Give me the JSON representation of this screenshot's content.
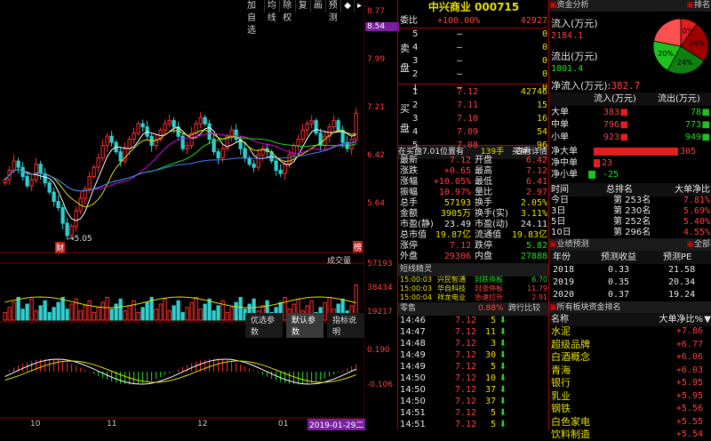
{
  "toolbar": {
    "items": [
      "加自选",
      "均线",
      "除权",
      "复",
      "画",
      "预测"
    ]
  },
  "price_axis": {
    "levels": [
      "8.77",
      "8.54",
      "7.99",
      "7.21",
      "6.42",
      "5.64"
    ],
    "highlight": "8.54",
    "low_marker": "5.05",
    "badge_left": "财",
    "badge_right": "榜"
  },
  "volume_panel": {
    "label": "成交量",
    "levels": [
      "57193",
      "38434",
      "19217"
    ]
  },
  "macd_panel": {
    "buttons": [
      "优选参数",
      "默认参数",
      "指标说明"
    ],
    "levels": [
      "0.190",
      "-0.106"
    ]
  },
  "x_axis": {
    "labels": [
      "10",
      "11",
      "12",
      "01"
    ],
    "cursor_date": "2019-01-29二"
  },
  "stock": {
    "title": "中兴商业 000715"
  },
  "committee": {
    "label": "委比",
    "ratio": "+100.00%",
    "diff": "42927"
  },
  "sell_label": [
    "卖",
    "盘"
  ],
  "buy_label": [
    "买",
    "盘"
  ],
  "asks": [
    {
      "lvl": "5",
      "price": "—",
      "vol": "0"
    },
    {
      "lvl": "4",
      "price": "—",
      "vol": "0"
    },
    {
      "lvl": "3",
      "price": "—",
      "vol": "0"
    },
    {
      "lvl": "2",
      "price": "—",
      "vol": "0"
    },
    {
      "lvl": "1",
      "price": "—",
      "vol": "0"
    }
  ],
  "bids": [
    {
      "lvl": "1",
      "price": "7.12",
      "vol": "42746"
    },
    {
      "lvl": "2",
      "price": "7.11",
      "vol": "15"
    },
    {
      "lvl": "3",
      "price": "7.10",
      "vol": "16"
    },
    {
      "lvl": "4",
      "price": "7.09",
      "vol": "54"
    },
    {
      "lvl": "5",
      "price": "7.08",
      "vol": "96"
    }
  ],
  "position_bar": {
    "text": "在买盘7.01位置有",
    "count": "139手",
    "buy": "买单!",
    "link": "查看详情"
  },
  "quote": [
    {
      "l1": "最新",
      "v1": "7.12",
      "l2": "开盘",
      "v2": "6.42"
    },
    {
      "l1": "涨跌",
      "v1": "+0.65",
      "l2": "最高",
      "v2": "7.12"
    },
    {
      "l1": "涨幅",
      "v1": "+10.05%",
      "l2": "最低",
      "v2": "6.41"
    },
    {
      "l1": "振幅",
      "v1": "10.97%",
      "l2": "量比",
      "v2": "2.97"
    },
    {
      "l1": "总手",
      "v1": "57193",
      "l2": "换手",
      "v2": "2.05%"
    },
    {
      "l1": "金额",
      "v1": "3905万",
      "l2": "换手(实)",
      "v2": "3.11%"
    },
    {
      "l1": "市盈(静)",
      "v1": "23.49",
      "l2": "市盈(动)",
      "v2": "24.11"
    },
    {
      "l1": "总市值",
      "v1": "19.87亿",
      "l2": "流通值",
      "v2": "19.83亿"
    },
    {
      "l1": "涨停",
      "v1": "7.12",
      "l2": "跌停",
      "v2": "5.82"
    },
    {
      "l1": "外盘",
      "v1": "29306",
      "l2": "内盘",
      "v2": "27888"
    }
  ],
  "spirit": {
    "title": "短线精灵",
    "rows": [
      {
        "t": "15:00:03",
        "name": "兴民智通",
        "evt": "封跌停板",
        "v": "6.70"
      },
      {
        "t": "15:00:03",
        "name": "华自科技",
        "evt": "封涨停板",
        "v": "11.79"
      },
      {
        "t": "15:00:04",
        "name": "祥龙电业",
        "evt": "急速拉升",
        "v": "2.91"
      }
    ]
  },
  "ticks": {
    "h1": "零售",
    "h2": "0.88%",
    "h3": "跨行比较",
    "rows": [
      {
        "t": "14:46",
        "p": "7.12",
        "v": "5",
        "d": "down"
      },
      {
        "t": "14:47",
        "p": "7.12",
        "v": "11",
        "d": "down"
      },
      {
        "t": "14:48",
        "p": "7.12",
        "v": "3",
        "d": "down"
      },
      {
        "t": "14:49",
        "p": "7.12",
        "v": "30",
        "d": "down"
      },
      {
        "t": "14:49",
        "p": "7.12",
        "v": "5",
        "d": "down"
      },
      {
        "t": "14:50",
        "p": "7.12",
        "v": "10",
        "d": "down"
      },
      {
        "t": "14:50",
        "p": "7.12",
        "v": "37",
        "d": "down"
      },
      {
        "t": "14:50",
        "p": "7.12",
        "v": "37",
        "d": "down"
      },
      {
        "t": "14:51",
        "p": "7.12",
        "v": "5",
        "d": "down"
      },
      {
        "t": "14:51",
        "p": "7.12",
        "v": "5",
        "d": "down"
      }
    ]
  },
  "fund": {
    "title": "资金分析",
    "tab": "排名",
    "inflow_label": "流入(万元)",
    "inflow": "2184.1",
    "outflow_label": "流出(万元)",
    "outflow": "1801.4",
    "net_label": "净流入(万元)",
    "net": "382.7",
    "pie": [
      {
        "label": "10%",
        "value": 10,
        "color": "#e02020"
      },
      {
        "label": "24%",
        "value": 24,
        "color": "#a00000"
      },
      {
        "label": "24%",
        "value": 24,
        "color": "#108010"
      },
      {
        "label": "20%",
        "value": 20,
        "color": "#20c020"
      },
      {
        "label": "",
        "value": 22,
        "color": "#ff5050"
      }
    ],
    "cols": [
      "流入(万元)",
      "流出(万元)"
    ],
    "rows": [
      {
        "name": "大单",
        "in": "383",
        "out": "78"
      },
      {
        "name": "中单",
        "in": "796",
        "out": "773"
      },
      {
        "name": "小单",
        "in": "923",
        "out": "949"
      }
    ],
    "net_rows": [
      {
        "name": "净大单",
        "v": "305",
        "frac": 0.95
      },
      {
        "name": "净中单",
        "v": "23",
        "frac": 0.07
      },
      {
        "name": "净小单",
        "v": "-25",
        "frac": 0.08
      }
    ],
    "rank_header": [
      "时间",
      "总排名",
      "大单净比"
    ],
    "rank_rows": [
      {
        "t": "今日",
        "r": "第 253名",
        "p": "7.81%"
      },
      {
        "t": "3日",
        "r": "第 230名",
        "p": "5.69%"
      },
      {
        "t": "5日",
        "r": "第 252名",
        "p": "5.40%"
      },
      {
        "t": "10日",
        "r": "第 296名",
        "p": "4.55%"
      }
    ]
  },
  "forecast": {
    "title": "业绩预测",
    "tab": "全部",
    "header": [
      "年份",
      "预测收益",
      "预测PE"
    ],
    "rows": [
      {
        "y": "2018",
        "e": "0.33",
        "pe": "21.58"
      },
      {
        "y": "2019",
        "e": "0.35",
        "pe": "20.34"
      },
      {
        "y": "2020",
        "e": "0.37",
        "pe": "19.24"
      }
    ]
  },
  "sectors": {
    "title": "所有板块资金排名",
    "header": [
      "名称",
      "大单净比%"
    ],
    "rows": [
      {
        "n": "水泥",
        "v": "+7.86"
      },
      {
        "n": "超级品牌",
        "v": "+6.77"
      },
      {
        "n": "白酒概念",
        "v": "+6.06"
      },
      {
        "n": "青海",
        "v": "+6.03"
      },
      {
        "n": "银行",
        "v": "+5.95"
      },
      {
        "n": "乳业",
        "v": "+5.95"
      },
      {
        "n": "钢铁",
        "v": "+5.56"
      },
      {
        "n": "白色家电",
        "v": "+5.55"
      },
      {
        "n": "饮料制造",
        "v": "+5.54"
      }
    ]
  },
  "chart_data": {
    "type": "candlestick",
    "y_range": [
      5.05,
      8.77
    ],
    "closes": [
      6.05,
      6.2,
      6.35,
      6.25,
      6.1,
      5.95,
      6.05,
      6.3,
      6.15,
      6.0,
      5.85,
      5.7,
      5.6,
      5.35,
      5.15,
      5.3,
      5.55,
      5.75,
      5.9,
      6.1,
      6.25,
      6.4,
      6.6,
      6.75,
      6.65,
      6.5,
      6.35,
      6.55,
      6.7,
      6.8,
      6.95,
      6.9,
      6.75,
      6.6,
      6.7,
      6.85,
      6.95,
      7.0,
      6.9,
      6.75,
      6.55,
      6.6,
      6.8,
      6.95,
      7.05,
      6.95,
      6.7,
      6.5,
      6.4,
      6.55,
      6.75,
      6.85,
      6.7,
      6.55,
      6.4,
      6.3,
      6.25,
      6.45,
      6.55,
      6.5,
      6.35,
      6.2,
      6.15,
      6.3,
      6.45,
      6.6,
      6.7,
      6.85,
      6.95,
      7.0,
      6.8,
      6.6,
      6.75,
      6.9,
      7.0,
      6.85,
      6.65,
      6.55,
      6.7,
      7.12
    ],
    "volume_max": 57193
  }
}
